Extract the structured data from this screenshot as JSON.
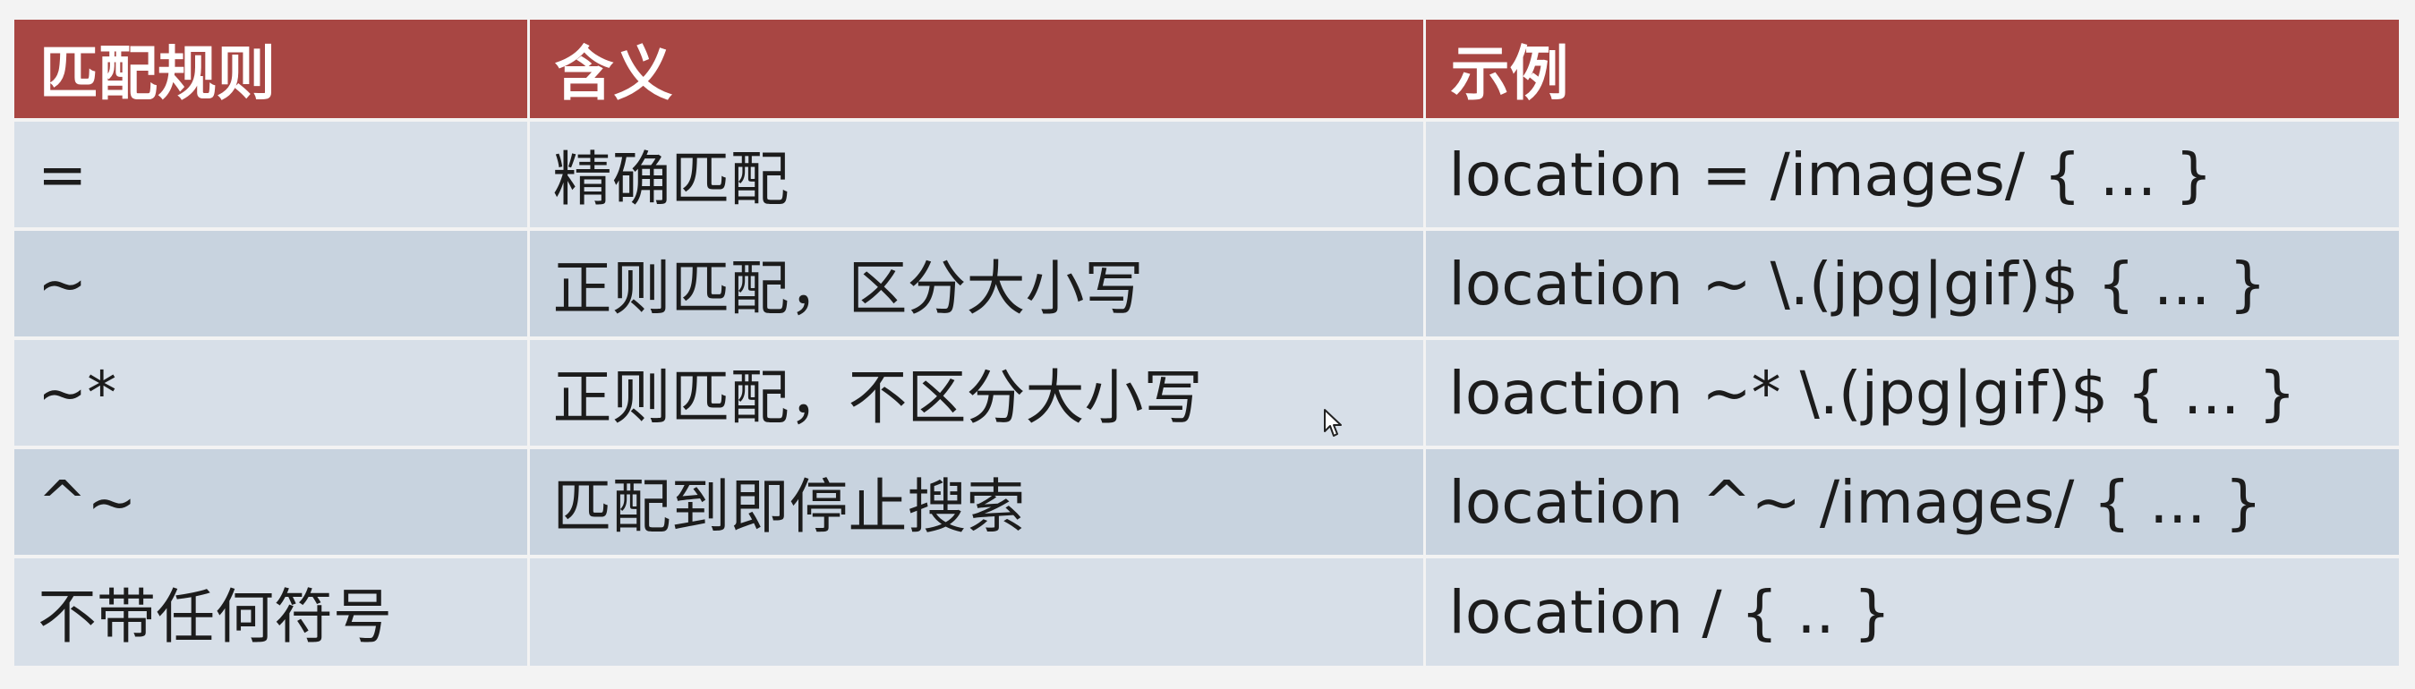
{
  "table": {
    "headers": [
      "匹配规则",
      "含义",
      "示例"
    ],
    "rows": [
      [
        "=",
        "精确匹配",
        "location = /images/ { ... }"
      ],
      [
        "~",
        "正则匹配，区分大小写",
        "location ~ \\.(jpg|gif)$ { ... }"
      ],
      [
        "~*",
        "正则匹配，不区分大小写",
        "loaction ~* \\.(jpg|gif)$ { ... }"
      ],
      [
        "^~",
        "匹配到即停止搜索",
        "location ^~ /images/ { ... }"
      ],
      [
        "不带任何符号",
        "",
        "location / { .. }"
      ]
    ]
  },
  "colors": {
    "header_bg": "#a84643",
    "header_text": "#ffffff",
    "row_light": "#d7dfe8",
    "row_dark": "#c8d3df"
  },
  "icons": {
    "cursor": "mouse-pointer-icon"
  }
}
